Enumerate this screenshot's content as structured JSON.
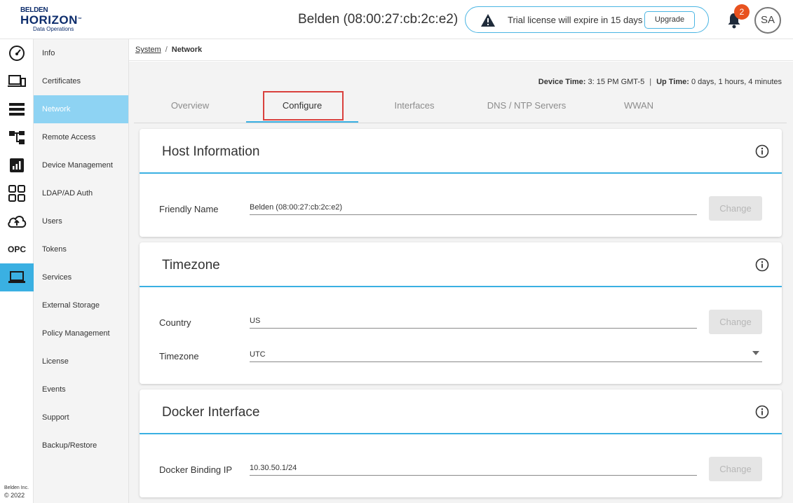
{
  "header": {
    "logo": {
      "brand": "BELDEN",
      "product": "HORIZON",
      "tm": "™",
      "sub": "Data Operations"
    },
    "device_title": "Belden (08:00:27:cb:2c:e2)",
    "trial_message": "Trial license will expire in 15 days",
    "upgrade_label": "Upgrade",
    "notifications_count": "2",
    "avatar_initials": "SA"
  },
  "rail": {
    "items": [
      {
        "icon": "dashboard-gauge-icon"
      },
      {
        "icon": "devices-icon"
      },
      {
        "icon": "list-icon"
      },
      {
        "icon": "hierarchy-icon"
      },
      {
        "icon": "analytics-chart-icon"
      },
      {
        "icon": "apps-grid-icon"
      },
      {
        "icon": "cloud-upload-icon"
      },
      {
        "icon": "opc-icon",
        "label": "OPC"
      },
      {
        "icon": "laptop-icon",
        "active": true
      }
    ],
    "copyright_company": "Belden Inc.",
    "copyright_year": "© 2022"
  },
  "submenu": {
    "items": [
      {
        "label": "Info"
      },
      {
        "label": "Certificates"
      },
      {
        "label": "Network",
        "active": true
      },
      {
        "label": "Remote Access"
      },
      {
        "label": "Device Management"
      },
      {
        "label": "LDAP/AD Auth"
      },
      {
        "label": "Users"
      },
      {
        "label": "Tokens"
      },
      {
        "label": "Services"
      },
      {
        "label": "External Storage"
      },
      {
        "label": "Policy Management"
      },
      {
        "label": "License"
      },
      {
        "label": "Events"
      },
      {
        "label": "Support"
      },
      {
        "label": "Backup/Restore"
      }
    ]
  },
  "breadcrumb": {
    "root": "System",
    "separator": "/",
    "current": "Network"
  },
  "status": {
    "device_time_label": "Device Time:",
    "device_time_value": "3: 15 PM GMT-5",
    "separator": "|",
    "up_time_label": "Up Time:",
    "up_time_value": "0 days, 1 hours, 4 minutes"
  },
  "tabs": [
    {
      "label": "Overview"
    },
    {
      "label": "Configure",
      "active": true
    },
    {
      "label": "Interfaces"
    },
    {
      "label": "DNS / NTP Servers"
    },
    {
      "label": "WWAN"
    }
  ],
  "cards": {
    "host": {
      "title": "Host Information",
      "friendly_name_label": "Friendly Name",
      "friendly_name_value": "Belden (08:00:27:cb:2c:e2)",
      "change_label": "Change"
    },
    "timezone": {
      "title": "Timezone",
      "country_label": "Country",
      "country_value": "US",
      "change_label": "Change",
      "timezone_label": "Timezone",
      "timezone_value": "UTC"
    },
    "docker": {
      "title": "Docker Interface",
      "binding_ip_label": "Docker Binding IP",
      "binding_ip_value": "10.30.50.1/24",
      "change_label": "Change"
    }
  },
  "colors": {
    "accent": "#3ab0e2",
    "active_submenu": "#8ed3f3",
    "badge": "#e8521f",
    "highlight_box": "#d9403d"
  }
}
